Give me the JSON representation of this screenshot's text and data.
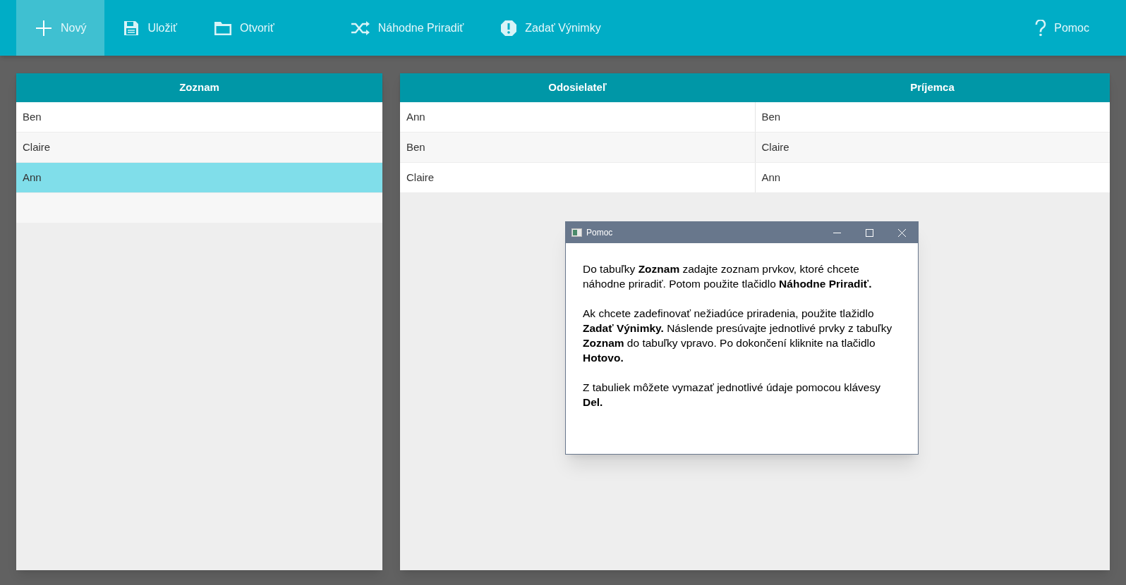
{
  "toolbar": {
    "buttons": [
      {
        "label": "Nový",
        "kind": "new",
        "selected": true
      },
      {
        "label": "Uložiť",
        "kind": "save",
        "selected": false
      },
      {
        "label": "Otvoriť",
        "kind": "open",
        "selected": false
      },
      {
        "label": "Náhodne Priradiť",
        "kind": "shuffle",
        "selected": false
      },
      {
        "label": "Zadať Výnimky",
        "kind": "exceptions",
        "selected": false
      },
      {
        "label": "Pomoc",
        "kind": "help",
        "selected": false
      }
    ]
  },
  "list_table": {
    "columns": [
      "Zoznam"
    ],
    "rows": [
      {
        "cells": [
          "Ben"
        ],
        "selected": false
      },
      {
        "cells": [
          "Claire"
        ],
        "selected": false
      },
      {
        "cells": [
          "Ann"
        ],
        "selected": true
      }
    ]
  },
  "pairs_table": {
    "columns": [
      "Odosielateľ",
      "Príjemca"
    ],
    "rows": [
      {
        "cells": [
          "Ann",
          "Ben"
        ],
        "selected": false
      },
      {
        "cells": [
          "Ben",
          "Claire"
        ],
        "selected": false
      },
      {
        "cells": [
          "Claire",
          "Ann"
        ],
        "selected": false
      }
    ]
  },
  "help_dialog": {
    "title": "Pomoc",
    "paragraphs": [
      "Do tabuľky **Zoznam** zadajte zoznam prvkov, ktoré chcete náhodne priradiť. Potom použite tlačidlo **Náhodne Priradiť.**",
      "Ak chcete zadefinovať nežiadúce priradenia, použite tlažidlo **Zadať Výnimky.** Náslende presúvajte jednotlivé prvky z tabuľky **Zoznam** do tabuľky vpravo. Po dokončení kliknite na tlačidlo **Hotovo.**",
      "Z tabuliek môžete vymazať jednotlivé údaje pomocou klávesy **Del.**"
    ]
  }
}
